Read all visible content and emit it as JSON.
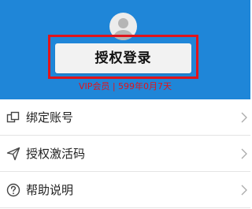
{
  "header": {
    "login_label": "授权登录",
    "vip_text": "VIP会员 | 599年0月7天",
    "accent_color": "#1f86d8",
    "highlight_color": "#e0141b"
  },
  "menu": {
    "items": [
      {
        "label": "绑定账号",
        "icon": "link-account-icon"
      },
      {
        "label": "授权激活码",
        "icon": "send-icon"
      },
      {
        "label": "帮助说明",
        "icon": "help-icon"
      }
    ]
  }
}
